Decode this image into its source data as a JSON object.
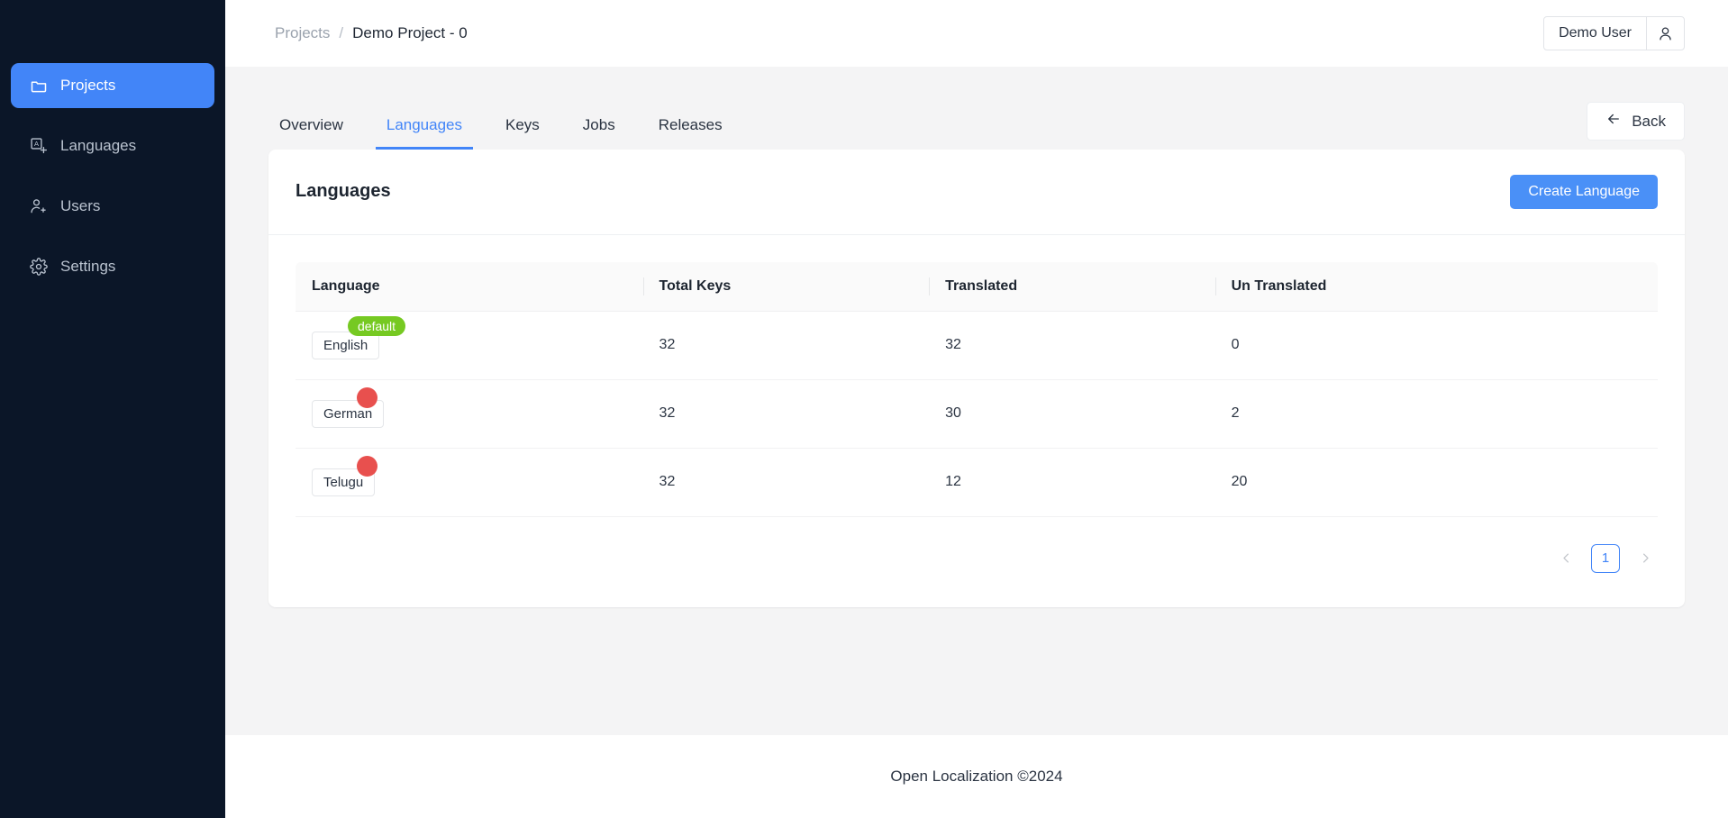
{
  "sidebar": {
    "items": [
      {
        "label": "Projects",
        "icon": "folder-icon",
        "active": true
      },
      {
        "label": "Languages",
        "icon": "translate-icon",
        "active": false
      },
      {
        "label": "Users",
        "icon": "users-icon",
        "active": false
      },
      {
        "label": "Settings",
        "icon": "gear-icon",
        "active": false
      }
    ],
    "background_color": "#0b1628",
    "active_color": "#4285f8"
  },
  "topbar": {
    "breadcrumb": {
      "root": "Projects",
      "separator": "/",
      "current": "Demo Project - 0"
    },
    "user": {
      "name": "Demo User",
      "icon": "user-icon"
    }
  },
  "tabs": [
    {
      "label": "Overview",
      "active": false
    },
    {
      "label": "Languages",
      "active": true
    },
    {
      "label": "Keys",
      "active": false
    },
    {
      "label": "Jobs",
      "active": false
    },
    {
      "label": "Releases",
      "active": false
    }
  ],
  "back_button": {
    "label": "Back",
    "icon": "arrow-left-icon"
  },
  "card": {
    "title": "Languages",
    "create_button": {
      "label": "Create Language",
      "color": "#4a90f7"
    }
  },
  "table": {
    "columns": [
      "Language",
      "Total Keys",
      "Translated",
      "Un Translated"
    ],
    "rows": [
      {
        "language": "English",
        "badge": "default",
        "badge_type": "text",
        "badge_color": "#76c922",
        "total_keys": "32",
        "translated": "32",
        "untranslated": "0"
      },
      {
        "language": "German",
        "badge": "",
        "badge_type": "dot",
        "badge_color": "#e8504e",
        "total_keys": "32",
        "translated": "30",
        "untranslated": "2"
      },
      {
        "language": "Telugu",
        "badge": "",
        "badge_type": "dot",
        "badge_color": "#e8504e",
        "total_keys": "32",
        "translated": "12",
        "untranslated": "20"
      }
    ]
  },
  "pagination": {
    "prev_icon": "chevron-left-icon",
    "current_page": "1",
    "next_icon": "chevron-right-icon"
  },
  "footer": {
    "text": "Open Localization ©2024"
  }
}
